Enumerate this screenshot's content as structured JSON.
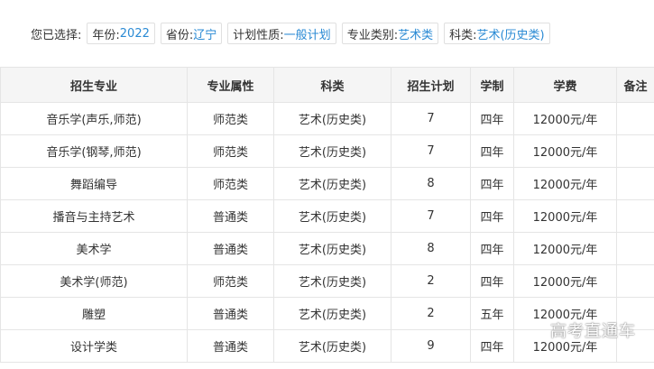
{
  "filters": {
    "prefix": "您已选择:",
    "items": [
      {
        "key": "年份:",
        "value": "2022"
      },
      {
        "key": "省份:",
        "value": "辽宁"
      },
      {
        "key": "计划性质:",
        "value": "一般计划"
      },
      {
        "key": "专业类别:",
        "value": "艺术类"
      },
      {
        "key": "科类:",
        "value": "艺术(历史类)"
      }
    ]
  },
  "table": {
    "headers": [
      "招生专业",
      "专业属性",
      "科类",
      "招生计划",
      "学制",
      "学费",
      "备注"
    ],
    "rows": [
      [
        "音乐学(声乐,师范)",
        "师范类",
        "艺术(历史类)",
        "7",
        "四年",
        "12000元/年",
        ""
      ],
      [
        "音乐学(钢琴,师范)",
        "师范类",
        "艺术(历史类)",
        "7",
        "四年",
        "12000元/年",
        ""
      ],
      [
        "舞蹈编导",
        "师范类",
        "艺术(历史类)",
        "8",
        "四年",
        "12000元/年",
        ""
      ],
      [
        "播音与主持艺术",
        "普通类",
        "艺术(历史类)",
        "7",
        "四年",
        "12000元/年",
        ""
      ],
      [
        "美术学",
        "普通类",
        "艺术(历史类)",
        "8",
        "四年",
        "12000元/年",
        ""
      ],
      [
        "美术学(师范)",
        "师范类",
        "艺术(历史类)",
        "2",
        "四年",
        "12000元/年",
        ""
      ],
      [
        "雕塑",
        "普通类",
        "艺术(历史类)",
        "2",
        "五年",
        "12000元/年",
        ""
      ],
      [
        "设计学类",
        "普通类",
        "艺术(历史类)",
        "9",
        "四年",
        "12000元/年",
        ""
      ]
    ]
  },
  "watermark": "高考直通车",
  "colors": {
    "accent": "#2a8ad4",
    "header_bg": "#f5f5f5",
    "border": "#e5e5e5"
  }
}
